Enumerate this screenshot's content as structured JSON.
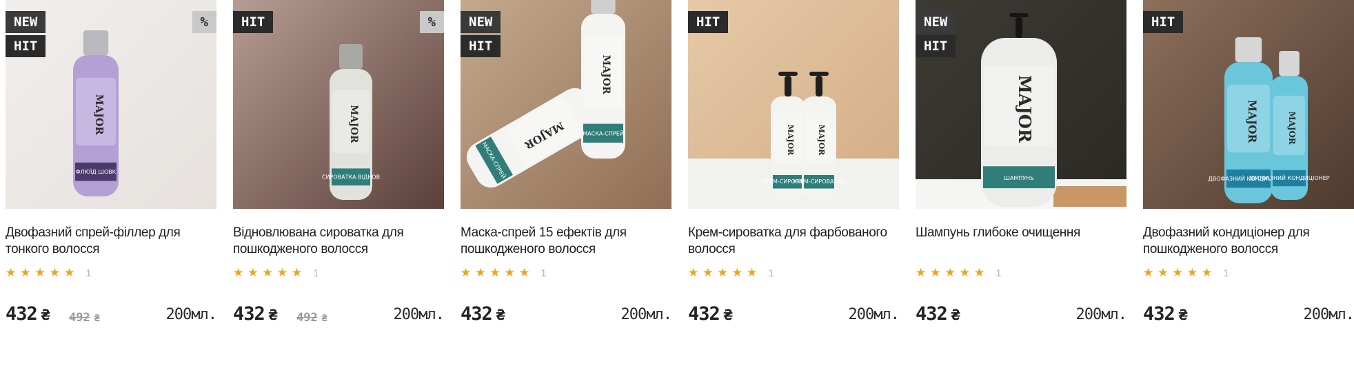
{
  "products": [
    {
      "badges": [
        "NEW",
        "HIT"
      ],
      "discount_badge": "%",
      "title_line1": "Двофазний спрей-філлер для",
      "title_line2": "тонкого волосся",
      "rating": 5,
      "review_count": "1",
      "price": "432",
      "old_price": "492",
      "currency": "₴",
      "volume": "200мл.",
      "label_text": "ФЛЮЇД ШОВК",
      "brand": "MAJOR",
      "colors": {
        "bg1": "#f1eeec",
        "bg2": "#e6e1dd",
        "bottle": "#b3a1d6",
        "cap": "#b9b9bd"
      }
    },
    {
      "badges": [
        "HIT"
      ],
      "discount_badge": "%",
      "title_line1": "Відновлювана сироватка для",
      "title_line2": "пошкодженого волосся",
      "rating": 5,
      "review_count": "1",
      "price": "432",
      "old_price": "492",
      "currency": "₴",
      "volume": "200мл.",
      "label_text": "СИРОВАТКА ВІДНОВ",
      "brand": "MAJOR",
      "colors": {
        "bg1": "#b69c92",
        "bg2": "#5c403a",
        "bottle": "#e2e2dd",
        "cap": "#a8a8a4"
      }
    },
    {
      "badges": [
        "NEW",
        "HIT"
      ],
      "discount_badge": "",
      "title_line1": "Маска-спрей 15 ефектів для",
      "title_line2": "пошкодженого волосся",
      "rating": 5,
      "review_count": "1",
      "price": "432",
      "old_price": "",
      "currency": "₴",
      "volume": "200мл.",
      "label_text": "МАСКА-СПРЕЙ",
      "brand": "MAJOR",
      "colors": {
        "bg1": "#c4a98d",
        "bg2": "#8f6e55",
        "bottle": "#f4f4f2",
        "cap": "#cfcfcf"
      }
    },
    {
      "badges": [
        "HIT"
      ],
      "discount_badge": "",
      "title_line1": "Крем-сироватка для фарбованого",
      "title_line2": "волосся",
      "rating": 5,
      "review_count": "1",
      "price": "432",
      "old_price": "",
      "currency": "₴",
      "volume": "200мл.",
      "label_text": "КРЕМ-СИРОВАТКА",
      "brand": "MAJOR",
      "colors": {
        "bg1": "#e6c9a7",
        "bg2": "#d2ac85",
        "bottle": "#f3f3f0",
        "cap": "#1f1f1f"
      }
    },
    {
      "badges": [
        "NEW",
        "HIT"
      ],
      "discount_badge": "",
      "title_line1": "Шампунь глибоке очищення",
      "title_line2": "",
      "rating": 5,
      "review_count": "1",
      "price": "432",
      "old_price": "",
      "currency": "₴",
      "volume": "200мл.",
      "label_text": "ШАМПУНЬ",
      "brand": "MAJOR",
      "colors": {
        "bg1": "#3d3a34",
        "bg2": "#2b2924",
        "bottle": "#ececea",
        "cap": "#151515"
      }
    },
    {
      "badges": [
        "HIT"
      ],
      "discount_badge": "",
      "title_line1": "Двофазний кондиціонер для",
      "title_line2": "пошкодженого волосся",
      "rating": 5,
      "review_count": "1",
      "price": "432",
      "old_price": "",
      "currency": "₴",
      "volume": "200мл.",
      "label_text": "ДВОФАЗНИЙ КОНДИЦІОНЕР",
      "brand": "MAJOR",
      "colors": {
        "bg1": "#8d6f5b",
        "bg2": "#4e3a2f",
        "bottle": "#69c6db",
        "cap": "#d6d6d6"
      }
    }
  ]
}
